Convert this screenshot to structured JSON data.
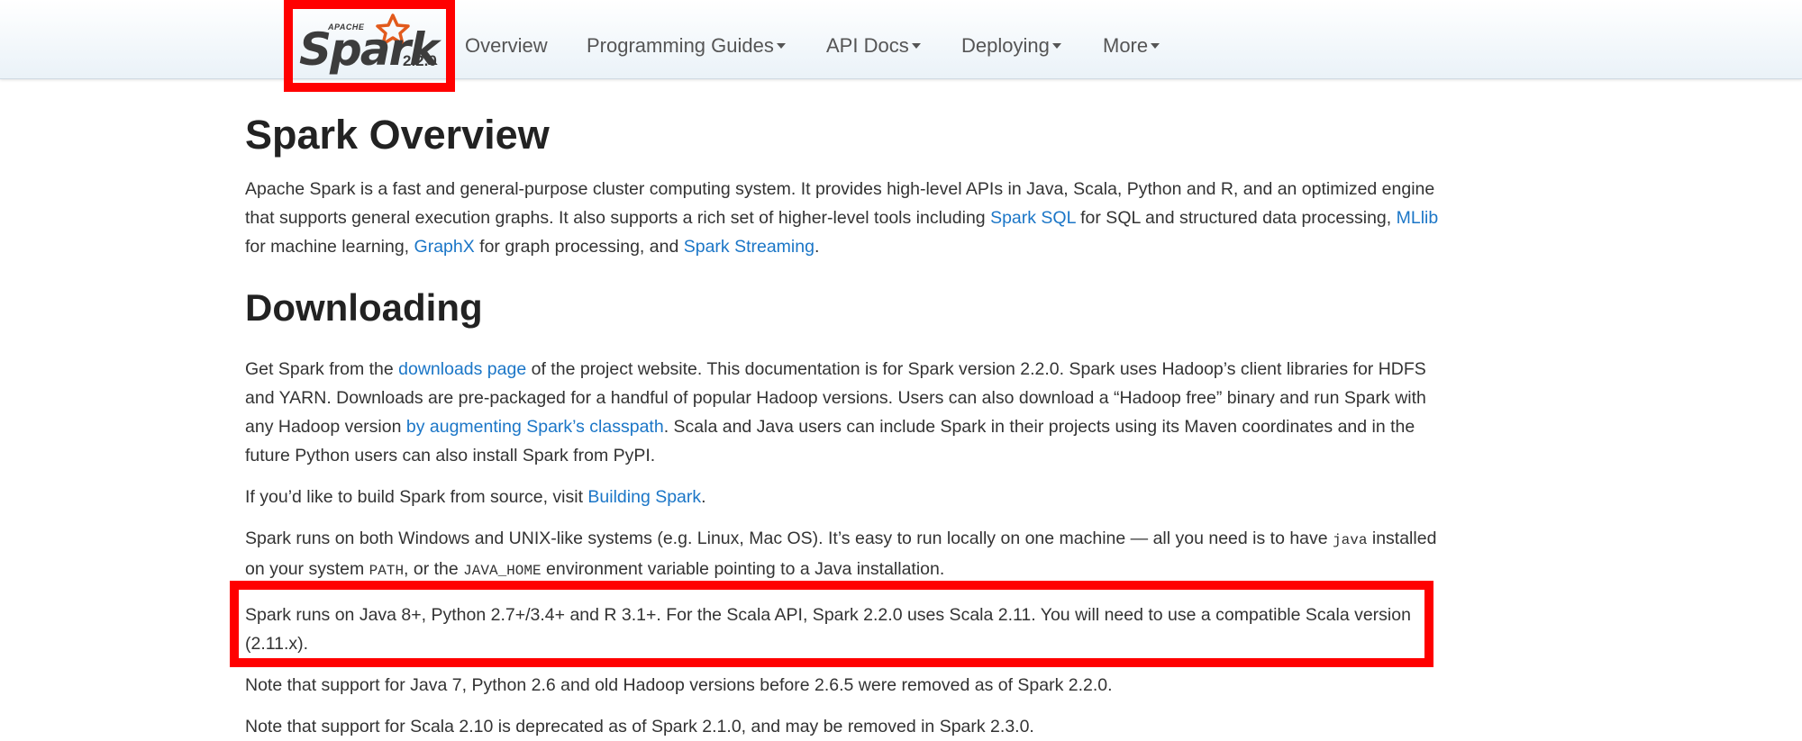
{
  "nav": {
    "brand": {
      "apache": "APACHE",
      "name": "Spark",
      "version": "2.2.0"
    },
    "items": [
      {
        "label": "Overview",
        "dropdown": false
      },
      {
        "label": "Programming Guides",
        "dropdown": true
      },
      {
        "label": "API Docs",
        "dropdown": true
      },
      {
        "label": "Deploying",
        "dropdown": true
      },
      {
        "label": "More",
        "dropdown": true
      }
    ]
  },
  "colors": {
    "link": "#1b76c7",
    "highlight": "#ff0000",
    "logo_star": "#e25a1c"
  },
  "icons": {
    "logo": "spark-star-logo-icon",
    "dropdown": "caret-down-icon"
  },
  "overview": {
    "title": "Spark Overview",
    "p1": {
      "t1": "Apache Spark is a fast and general-purpose cluster computing system. It provides high-level APIs in Java, Scala, Python and R, and an optimized engine that supports general execution graphs. It also supports a rich set of higher-level tools including ",
      "link_sql": "Spark SQL",
      "t2": " for SQL and structured data processing, ",
      "link_mllib": "MLlib",
      "t3": " for machine learning, ",
      "link_graphx": "GraphX",
      "t4": " for graph processing, and ",
      "link_streaming": "Spark Streaming",
      "t5": "."
    }
  },
  "downloading": {
    "title": "Downloading",
    "p1": {
      "t1": "Get Spark from the ",
      "link_downloads": "downloads page",
      "t2": " of the project website. This documentation is for Spark version 2.2.0. Spark uses Hadoop’s client libraries for HDFS and YARN. Downloads are pre-packaged for a handful of popular Hadoop versions. Users can also download a “Hadoop free” binary and run Spark with any Hadoop version ",
      "link_classpath": "by augmenting Spark’s classpath",
      "t3": ". Scala and Java users can include Spark in their projects using its Maven coordinates and in the future Python users can also install Spark from PyPI."
    },
    "p2": {
      "t1": "If you’d like to build Spark from source, visit ",
      "link_building": "Building Spark",
      "t2": "."
    },
    "p3": {
      "t1": "Spark runs on both Windows and UNIX-like systems (e.g. Linux, Mac OS). It’s easy to run locally on one machine — all you need is to have ",
      "code_java": "java",
      "t2": " installed on your system ",
      "code_path": "PATH",
      "t3": ", or the ",
      "code_java_home": "JAVA_HOME",
      "t4": " environment variable pointing to a Java installation."
    },
    "p4": "Spark runs on Java 8+, Python 2.7+/3.4+ and R 3.1+. For the Scala API, Spark 2.2.0 uses Scala 2.11. You will need to use a compatible Scala version (2.11.x).",
    "p5": "Note that support for Java 7, Python 2.6 and old Hadoop versions before 2.6.5 were removed as of Spark 2.2.0.",
    "p6": "Note that support for Scala 2.10 is deprecated as of Spark 2.1.0, and may be removed in Spark 2.3.0."
  }
}
